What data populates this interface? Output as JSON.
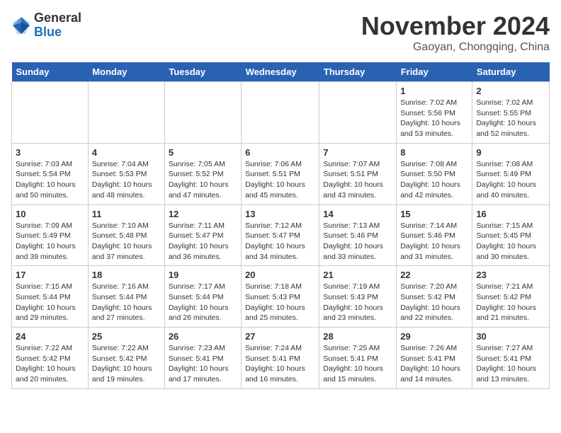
{
  "logo": {
    "general": "General",
    "blue": "Blue"
  },
  "header": {
    "month": "November 2024",
    "location": "Gaoyan, Chongqing, China"
  },
  "weekdays": [
    "Sunday",
    "Monday",
    "Tuesday",
    "Wednesday",
    "Thursday",
    "Friday",
    "Saturday"
  ],
  "weeks": [
    [
      {
        "day": "",
        "info": ""
      },
      {
        "day": "",
        "info": ""
      },
      {
        "day": "",
        "info": ""
      },
      {
        "day": "",
        "info": ""
      },
      {
        "day": "",
        "info": ""
      },
      {
        "day": "1",
        "info": "Sunrise: 7:02 AM\nSunset: 5:56 PM\nDaylight: 10 hours\nand 53 minutes."
      },
      {
        "day": "2",
        "info": "Sunrise: 7:02 AM\nSunset: 5:55 PM\nDaylight: 10 hours\nand 52 minutes."
      }
    ],
    [
      {
        "day": "3",
        "info": "Sunrise: 7:03 AM\nSunset: 5:54 PM\nDaylight: 10 hours\nand 50 minutes."
      },
      {
        "day": "4",
        "info": "Sunrise: 7:04 AM\nSunset: 5:53 PM\nDaylight: 10 hours\nand 48 minutes."
      },
      {
        "day": "5",
        "info": "Sunrise: 7:05 AM\nSunset: 5:52 PM\nDaylight: 10 hours\nand 47 minutes."
      },
      {
        "day": "6",
        "info": "Sunrise: 7:06 AM\nSunset: 5:51 PM\nDaylight: 10 hours\nand 45 minutes."
      },
      {
        "day": "7",
        "info": "Sunrise: 7:07 AM\nSunset: 5:51 PM\nDaylight: 10 hours\nand 43 minutes."
      },
      {
        "day": "8",
        "info": "Sunrise: 7:08 AM\nSunset: 5:50 PM\nDaylight: 10 hours\nand 42 minutes."
      },
      {
        "day": "9",
        "info": "Sunrise: 7:08 AM\nSunset: 5:49 PM\nDaylight: 10 hours\nand 40 minutes."
      }
    ],
    [
      {
        "day": "10",
        "info": "Sunrise: 7:09 AM\nSunset: 5:49 PM\nDaylight: 10 hours\nand 39 minutes."
      },
      {
        "day": "11",
        "info": "Sunrise: 7:10 AM\nSunset: 5:48 PM\nDaylight: 10 hours\nand 37 minutes."
      },
      {
        "day": "12",
        "info": "Sunrise: 7:11 AM\nSunset: 5:47 PM\nDaylight: 10 hours\nand 36 minutes."
      },
      {
        "day": "13",
        "info": "Sunrise: 7:12 AM\nSunset: 5:47 PM\nDaylight: 10 hours\nand 34 minutes."
      },
      {
        "day": "14",
        "info": "Sunrise: 7:13 AM\nSunset: 5:46 PM\nDaylight: 10 hours\nand 33 minutes."
      },
      {
        "day": "15",
        "info": "Sunrise: 7:14 AM\nSunset: 5:46 PM\nDaylight: 10 hours\nand 31 minutes."
      },
      {
        "day": "16",
        "info": "Sunrise: 7:15 AM\nSunset: 5:45 PM\nDaylight: 10 hours\nand 30 minutes."
      }
    ],
    [
      {
        "day": "17",
        "info": "Sunrise: 7:15 AM\nSunset: 5:44 PM\nDaylight: 10 hours\nand 29 minutes."
      },
      {
        "day": "18",
        "info": "Sunrise: 7:16 AM\nSunset: 5:44 PM\nDaylight: 10 hours\nand 27 minutes."
      },
      {
        "day": "19",
        "info": "Sunrise: 7:17 AM\nSunset: 5:44 PM\nDaylight: 10 hours\nand 26 minutes."
      },
      {
        "day": "20",
        "info": "Sunrise: 7:18 AM\nSunset: 5:43 PM\nDaylight: 10 hours\nand 25 minutes."
      },
      {
        "day": "21",
        "info": "Sunrise: 7:19 AM\nSunset: 5:43 PM\nDaylight: 10 hours\nand 23 minutes."
      },
      {
        "day": "22",
        "info": "Sunrise: 7:20 AM\nSunset: 5:42 PM\nDaylight: 10 hours\nand 22 minutes."
      },
      {
        "day": "23",
        "info": "Sunrise: 7:21 AM\nSunset: 5:42 PM\nDaylight: 10 hours\nand 21 minutes."
      }
    ],
    [
      {
        "day": "24",
        "info": "Sunrise: 7:22 AM\nSunset: 5:42 PM\nDaylight: 10 hours\nand 20 minutes."
      },
      {
        "day": "25",
        "info": "Sunrise: 7:22 AM\nSunset: 5:42 PM\nDaylight: 10 hours\nand 19 minutes."
      },
      {
        "day": "26",
        "info": "Sunrise: 7:23 AM\nSunset: 5:41 PM\nDaylight: 10 hours\nand 17 minutes."
      },
      {
        "day": "27",
        "info": "Sunrise: 7:24 AM\nSunset: 5:41 PM\nDaylight: 10 hours\nand 16 minutes."
      },
      {
        "day": "28",
        "info": "Sunrise: 7:25 AM\nSunset: 5:41 PM\nDaylight: 10 hours\nand 15 minutes."
      },
      {
        "day": "29",
        "info": "Sunrise: 7:26 AM\nSunset: 5:41 PM\nDaylight: 10 hours\nand 14 minutes."
      },
      {
        "day": "30",
        "info": "Sunrise: 7:27 AM\nSunset: 5:41 PM\nDaylight: 10 hours\nand 13 minutes."
      }
    ]
  ]
}
